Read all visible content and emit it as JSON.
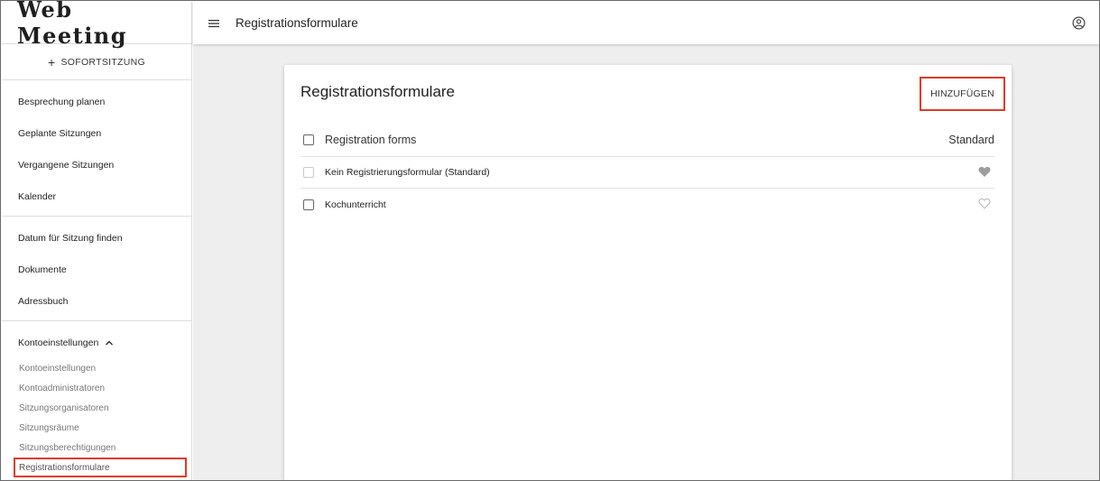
{
  "app": {
    "logo": "Web Meeting"
  },
  "sidebar": {
    "instant": {
      "icon": "plus-icon",
      "label": "SOFORTSITZUNG"
    },
    "group1": [
      {
        "label": "Besprechung planen"
      },
      {
        "label": "Geplante Sitzungen"
      },
      {
        "label": "Vergangene Sitzungen"
      },
      {
        "label": "Kalender"
      }
    ],
    "group2": [
      {
        "label": "Datum für Sitzung finden"
      },
      {
        "label": "Dokumente"
      },
      {
        "label": "Adressbuch"
      }
    ],
    "account": {
      "label": "Kontoeinstellungen",
      "icon": "chevron-up-icon",
      "items": [
        {
          "label": "Kontoeinstellungen"
        },
        {
          "label": "Kontoadministratoren"
        },
        {
          "label": "Sitzungsorganisatoren"
        },
        {
          "label": "Sitzungsräume"
        },
        {
          "label": "Sitzungsberechtigungen"
        },
        {
          "label": "Registrationsformulare",
          "active": true
        }
      ]
    }
  },
  "topbar": {
    "menu_icon": "hamburger-icon",
    "title": "Registrationsformulare",
    "user_icon": "user-icon"
  },
  "card": {
    "title": "Registrationsformulare",
    "add_label": "HINZUFÜGEN",
    "table": {
      "header": {
        "name": "Registration forms",
        "default": "Standard"
      },
      "rows": [
        {
          "name": "Kein Registrierungsformular (Standard)",
          "favorite": true
        },
        {
          "name": "Kochunterricht",
          "favorite": false
        }
      ]
    }
  },
  "colors": {
    "highlight": "#e23a24",
    "background": "#eeeeee",
    "heart_filled": "#9e9e9e",
    "heart_outline": "#bdbdbd"
  }
}
